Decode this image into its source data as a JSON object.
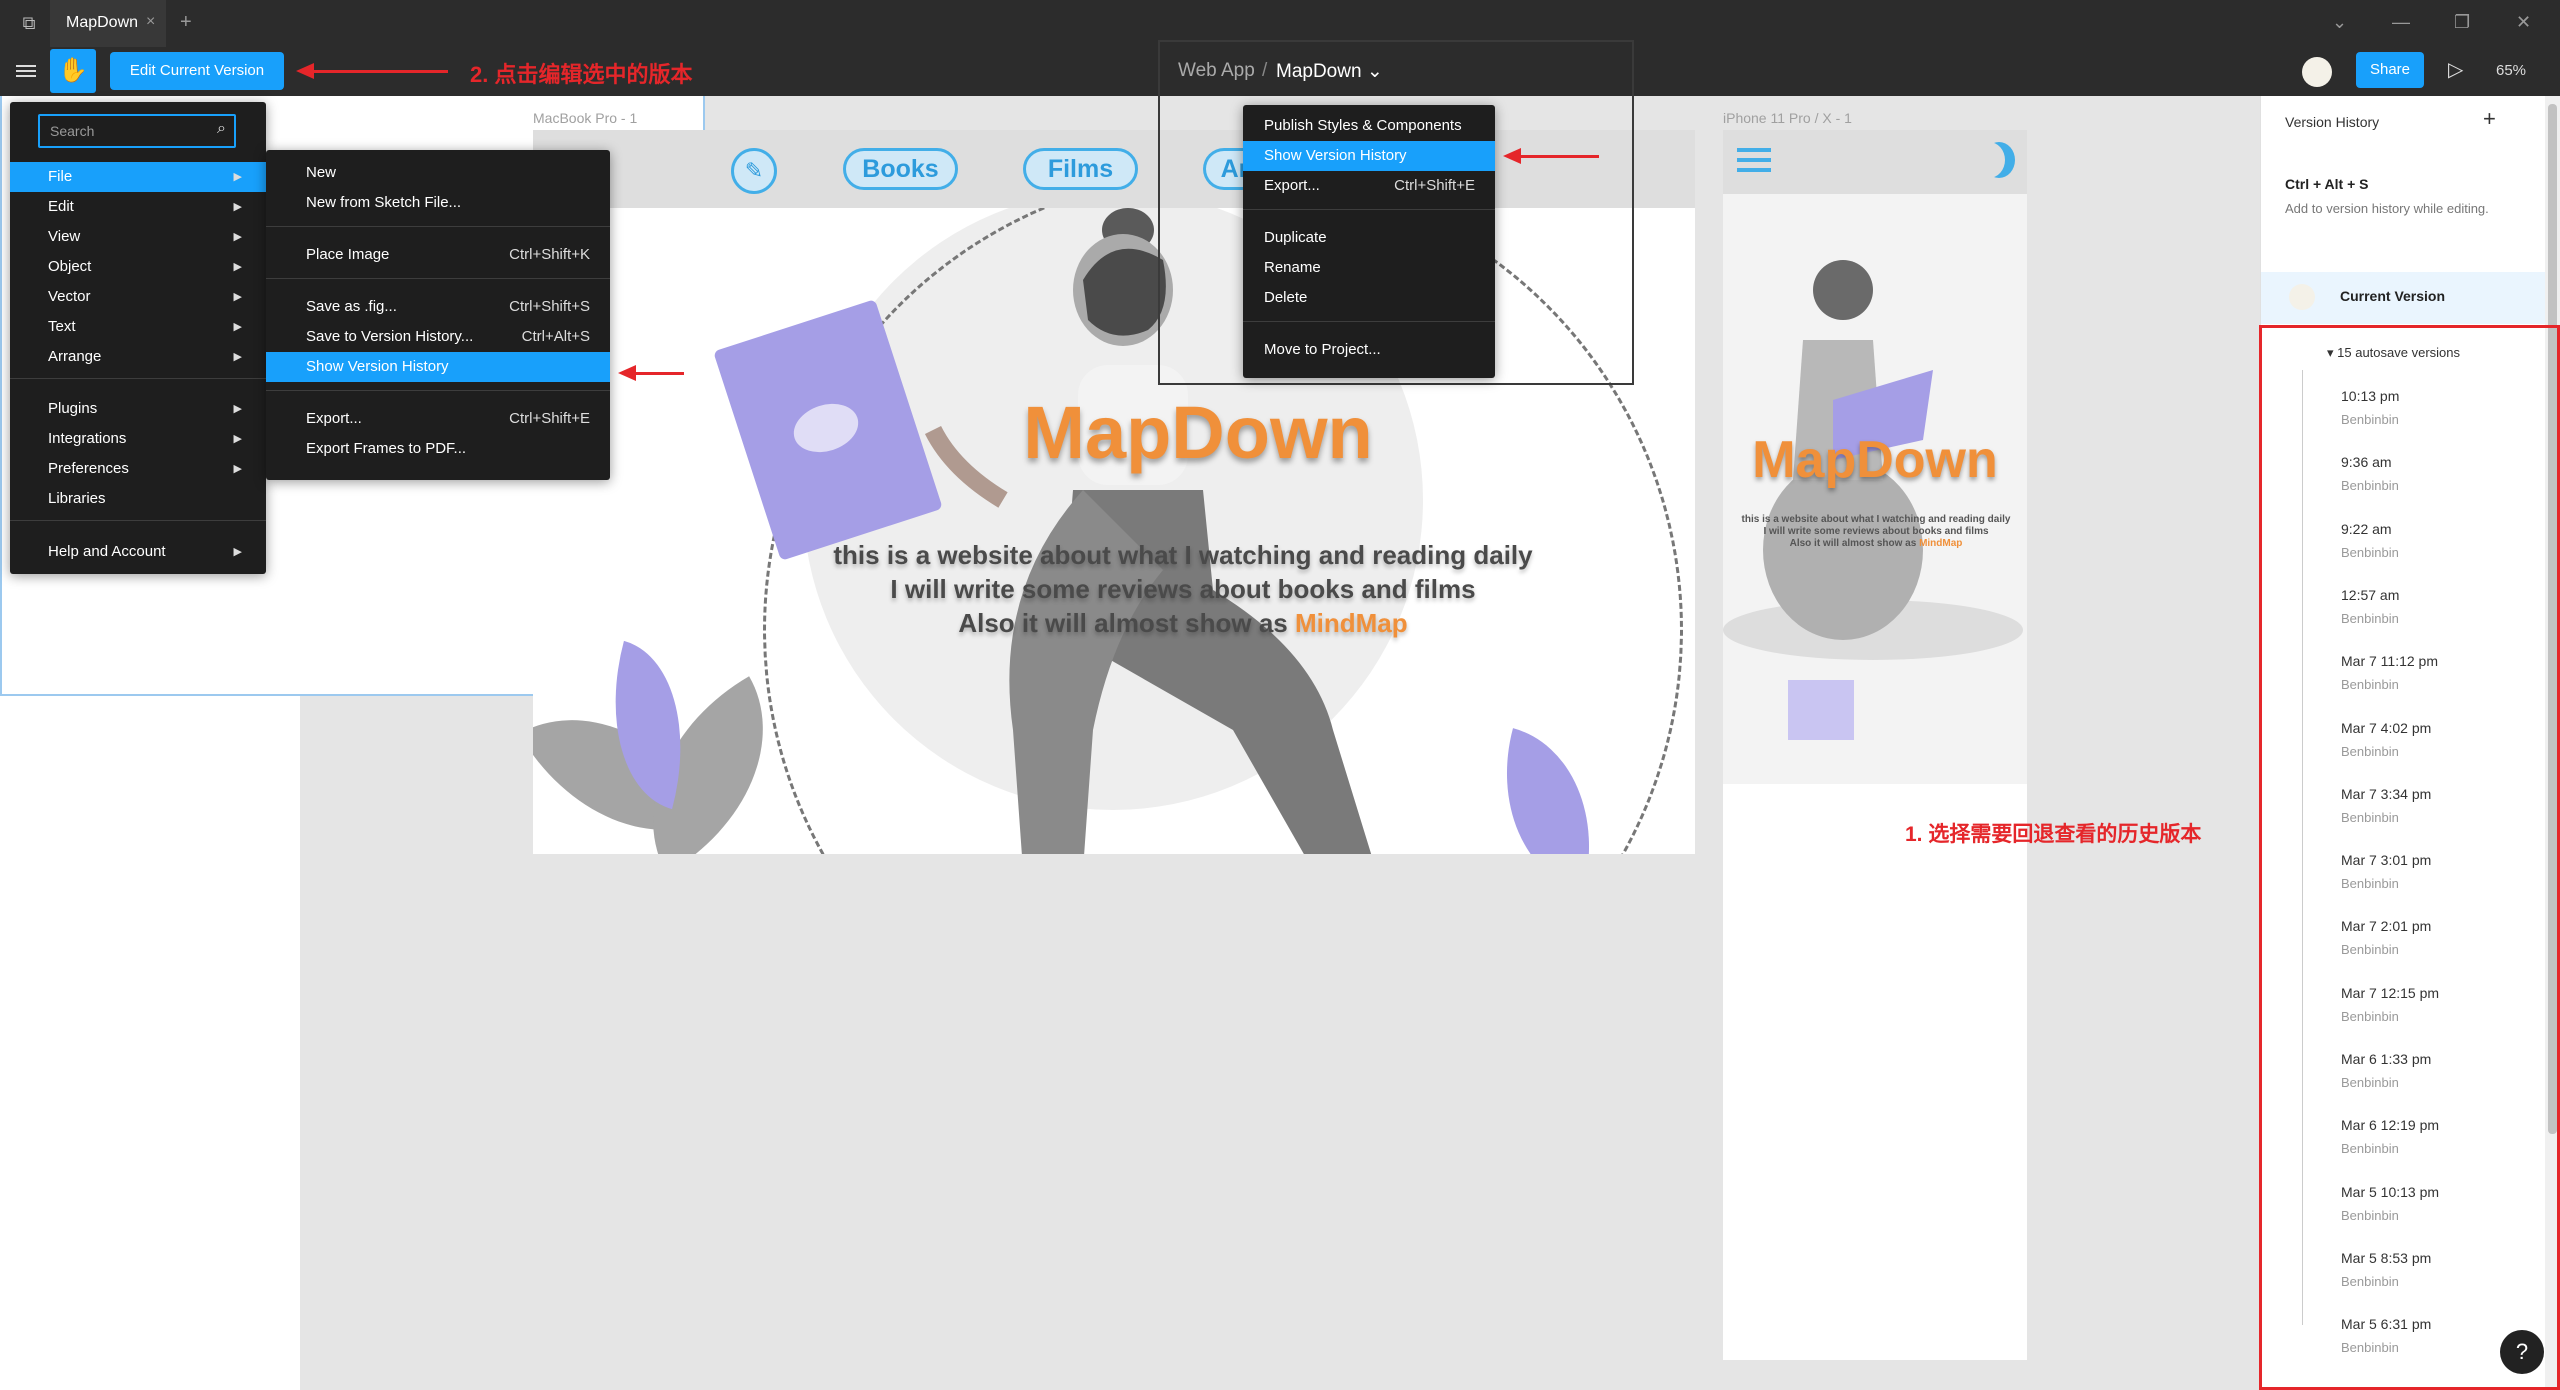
{
  "titlebar": {
    "tab_name": "MapDown",
    "tab_close": "×",
    "new_tab": "+",
    "controls": [
      "⌄",
      "—",
      "❐",
      "✕"
    ]
  },
  "toolbar": {
    "edit_button": "Edit Current Version",
    "annotation_edit": "2. 点击编辑选中的版本",
    "breadcrumb_project": "Web App",
    "breadcrumb_sep": "/",
    "breadcrumb_file": "MapDown ⌄",
    "share_label": "Share",
    "zoom_label": "65%",
    "play_icon": "▷"
  },
  "main_menu": {
    "search_placeholder": "Search",
    "items": [
      {
        "label": "File",
        "arrow": "▶",
        "highlighted": true
      },
      {
        "label": "Edit",
        "arrow": "▶"
      },
      {
        "label": "View",
        "arrow": "▶"
      },
      {
        "label": "Object",
        "arrow": "▶"
      },
      {
        "label": "Vector",
        "arrow": "▶"
      },
      {
        "label": "Text",
        "arrow": "▶"
      },
      {
        "label": "Arrange",
        "arrow": "▶"
      },
      {
        "label": "Plugins",
        "arrow": "▶"
      },
      {
        "label": "Integrations",
        "arrow": "▶"
      },
      {
        "label": "Preferences",
        "arrow": "▶"
      },
      {
        "label": "Libraries",
        "arrow": ""
      },
      {
        "label": "Help and Account",
        "arrow": "▶"
      }
    ]
  },
  "file_menu": {
    "items": [
      {
        "label": "New",
        "shortcut": ""
      },
      {
        "label": "New from Sketch File...",
        "shortcut": ""
      },
      {
        "label": "Place Image",
        "shortcut": "Ctrl+Shift+K"
      },
      {
        "label": "Save as .fig...",
        "shortcut": "Ctrl+Shift+S"
      },
      {
        "label": "Save to Version History...",
        "shortcut": "Ctrl+Alt+S"
      },
      {
        "label": "Show Version History",
        "shortcut": "",
        "highlighted": true
      },
      {
        "label": "Export...",
        "shortcut": "Ctrl+Shift+E"
      },
      {
        "label": "Export Frames to PDF...",
        "shortcut": ""
      }
    ]
  },
  "page_menu": {
    "items": [
      {
        "label": "Publish Styles & Components",
        "shortcut": ""
      },
      {
        "label": "Show Version History",
        "shortcut": "",
        "highlighted": true
      },
      {
        "label": "Export...",
        "shortcut": "Ctrl+Shift+E"
      },
      {
        "label": "Duplicate",
        "shortcut": ""
      },
      {
        "label": "Rename",
        "shortcut": ""
      },
      {
        "label": "Delete",
        "shortcut": ""
      },
      {
        "label": "Move to Project...",
        "shortcut": ""
      }
    ]
  },
  "canvas": {
    "mac_label": "MacBook Pro - 1",
    "iphone_label": "iPhone 11 Pro / X - 1",
    "nav_books": "Books",
    "nav_films": "Films",
    "nav_partial": "Ar",
    "pen_icon": "✎",
    "title": "MapDown",
    "sub_line1": "this is a website about what I watching and reading daily",
    "sub_line2": "I will write some reviews about books and films",
    "sub_line3_prefix": "Also it will almost show as ",
    "sub_line3_highlight": "MindMap",
    "annotation_select": "1. 选择需要回退查看的历史版本"
  },
  "version_panel": {
    "title": "Version History",
    "add_icon": "+",
    "shortcut": "Ctrl + Alt + S",
    "hint": "Add to version history while editing.",
    "current_version": "Current Version",
    "autosave_label": "▾  15 autosave versions",
    "versions": [
      {
        "time": "10:13 pm",
        "author": "Benbinbin"
      },
      {
        "time": "9:36 am",
        "author": "Benbinbin"
      },
      {
        "time": "9:22 am",
        "author": "Benbinbin"
      },
      {
        "time": "12:57 am",
        "author": "Benbinbin"
      },
      {
        "time": "Mar 7 11:12 pm",
        "author": "Benbinbin"
      },
      {
        "time": "Mar 7 4:02 pm",
        "author": "Benbinbin"
      },
      {
        "time": "Mar 7 3:34 pm",
        "author": "Benbinbin"
      },
      {
        "time": "Mar 7 3:01 pm",
        "author": "Benbinbin"
      },
      {
        "time": "Mar 7 2:01 pm",
        "author": "Benbinbin"
      },
      {
        "time": "Mar 7 12:15 pm",
        "author": "Benbinbin"
      },
      {
        "time": "Mar 6 1:33 pm",
        "author": "Benbinbin"
      },
      {
        "time": "Mar 6 12:19 pm",
        "author": "Benbinbin"
      },
      {
        "time": "Mar 5 10:13 pm",
        "author": "Benbinbin"
      },
      {
        "time": "Mar 5 8:53 pm",
        "author": "Benbinbin"
      },
      {
        "time": "Mar 5 6:31 pm",
        "author": "Benbinbin"
      }
    ],
    "help_icon": "?"
  },
  "colors": {
    "accent": "#18a0fb",
    "annotation": "#e5262a",
    "brand_orange": "#f0903a"
  }
}
